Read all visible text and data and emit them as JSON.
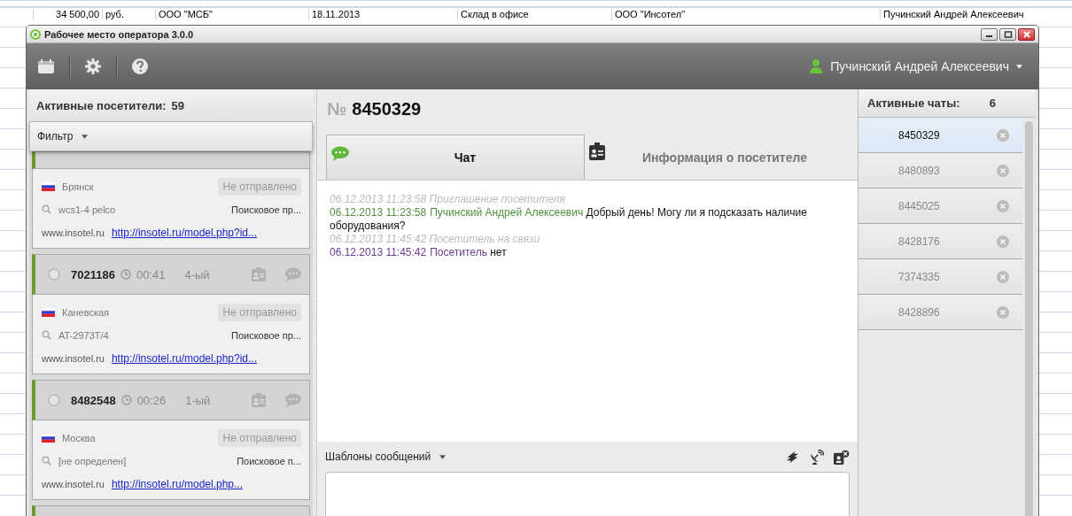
{
  "spreadsheet": {
    "row": [
      "34 500,00",
      "руб.",
      "ООО \"МСБ\"",
      "18.11.2013",
      "Склад в офисе",
      "ООО \"Инсотел\"",
      "Пучинский Андрей Алексеевич"
    ]
  },
  "window": {
    "title": "Рабочее место оператора 3.0.0"
  },
  "toolbar": {
    "user": "Пучинский Андрей Алексеевич"
  },
  "visitors_panel": {
    "title": "Активные посетители:",
    "count": "59",
    "filter": "Фильтр",
    "visitors": [
      {
        "city": "Брянск",
        "status": "Не отправлено",
        "query": "wcs1-4 pelco",
        "source": "Поисковое пр...",
        "site": "www.insotel.ru",
        "link": "http://insotel.ru/model.php?id..."
      },
      {
        "number": "7021186",
        "time": "00:41",
        "visit": "4-ый",
        "city": "Каневская",
        "status": "Не отправлено",
        "query": "AT-2973T/4",
        "source": "Поисковое пр...",
        "site": "www.insotel.ru",
        "link": "http://insotel.ru/model.php?id..."
      },
      {
        "number": "8482548",
        "time": "00:26",
        "visit": "1-ый",
        "city": "Москва",
        "status": "Не отправлено",
        "query": "[не определен]",
        "source": "Поисковое п...",
        "site": "www.insotel.ru",
        "link": "http://insotel.ru/model.php..."
      }
    ]
  },
  "chat": {
    "number_sign": "№",
    "number": "8450329",
    "tabs": [
      {
        "label": "Чат",
        "kind": "chat",
        "selected": true
      },
      {
        "label": "Информация о посетителе",
        "kind": "info",
        "selected": false
      }
    ],
    "messages": [
      {
        "kind": "system",
        "time": "06.12.2013 11:23:58",
        "text": "Приглашение посетителя"
      },
      {
        "kind": "operator",
        "time": "06.12.2013 11:23:58",
        "author": "Пучинский Андрей Алексеевич",
        "text": "Добрый день! Могу ли я подсказать наличие оборудования?"
      },
      {
        "kind": "system",
        "time": "06.12.2013 11:45:42",
        "text": "Посетитель на связи"
      },
      {
        "kind": "visitor",
        "time": "06.12.2013 11:45:42",
        "author": "Посетитель",
        "text": "нет"
      }
    ],
    "templates": "Шаблоны сообщений"
  },
  "chats_panel": {
    "title": "Активные чаты:",
    "count": "6",
    "chats": [
      {
        "number": "8450329",
        "selected": true
      },
      {
        "number": "8480893",
        "selected": false
      },
      {
        "number": "8445025",
        "selected": false
      },
      {
        "number": "8428176",
        "selected": false
      },
      {
        "number": "7374335",
        "selected": false
      },
      {
        "number": "8428896",
        "selected": false
      }
    ]
  }
}
